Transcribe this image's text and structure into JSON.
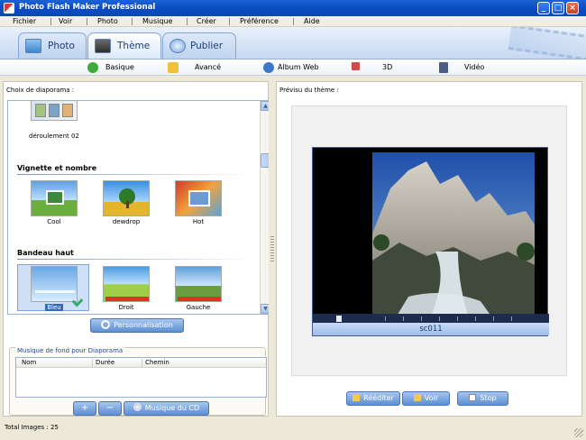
{
  "window": {
    "title": "Photo Flash Maker Professional"
  },
  "menu": [
    "Fichier",
    "Voir",
    "Photo",
    "Musique",
    "Créer",
    "Préférence",
    "Aide"
  ],
  "tabs": [
    {
      "label": "Photo",
      "active": false
    },
    {
      "label": "Thème",
      "active": true
    },
    {
      "label": "Publier",
      "active": false
    }
  ],
  "subtoolbar": [
    {
      "label": "Basique",
      "icon": "check-icon"
    },
    {
      "label": "Avancé",
      "icon": "star-icon"
    },
    {
      "label": "Album Web",
      "icon": "globe-icon"
    },
    {
      "label": "3D",
      "icon": "3d-icon"
    },
    {
      "label": "Vidéo",
      "icon": "film-icon"
    }
  ],
  "left": {
    "choice_label": "Choix de diaporama :",
    "first_caption": "déroulement 02",
    "sections": [
      {
        "title": "Vignette et nombre",
        "items": [
          "Cool",
          "dewdrop",
          "Hot"
        ]
      },
      {
        "title": "Bandeau haut",
        "items": [
          "Bleu",
          "Droit",
          "Gauche"
        ],
        "selected": "Bleu"
      }
    ],
    "customize_button": "Personnalisation",
    "music_group_label": "Musique de fond pour Diaporama",
    "music_columns": [
      "Nom",
      "Durée",
      "Chemin"
    ],
    "add_button": "+",
    "remove_button": "−",
    "cd_button": "Musique du CD"
  },
  "right": {
    "preview_label": "Prévisu du thème :",
    "preview_caption": "sc011",
    "buttons": {
      "replay": "Rééditer",
      "view": "Voir",
      "stop": "Stop"
    }
  },
  "status": {
    "total": "Total Images : 25"
  },
  "colors": {
    "titlebar": "#0a4cc2",
    "accent": "#316ac5",
    "panel": "#ece9d8"
  }
}
